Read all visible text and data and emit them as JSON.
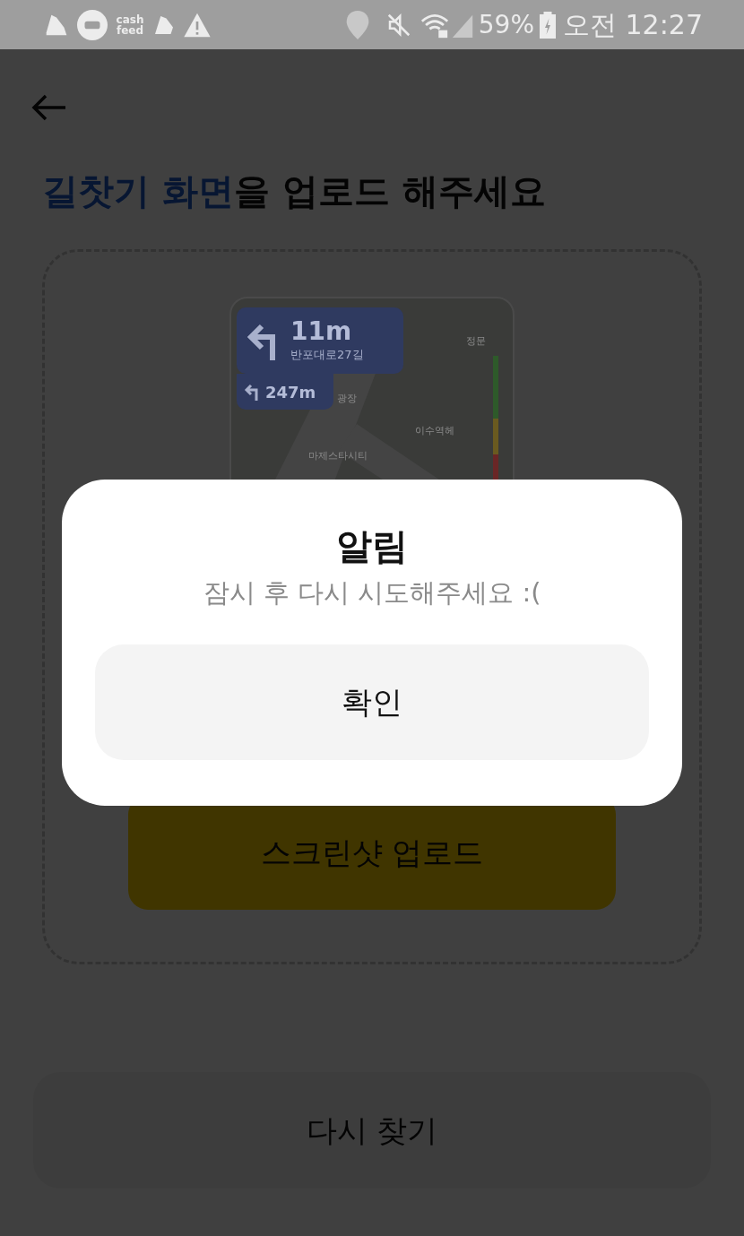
{
  "status_bar": {
    "app_label": "cash feed",
    "battery": "59%",
    "time": "오전 12:27"
  },
  "heading": {
    "highlight": "길찻기 화면",
    "rest": "을 업로드 해주세요"
  },
  "example_screen": {
    "distance": "11m",
    "street": "반포대로27길",
    "next_distance": "247m",
    "map_labels": [
      "정문",
      "광장",
      "이수역헤",
      "마제스타시티"
    ]
  },
  "upload_button": "스크린샷 업로드",
  "retry_button": "다시 찾기",
  "dialog": {
    "title": "알림",
    "message": "잠시 후 다시 시도해주세요 :(",
    "confirm": "확인"
  }
}
